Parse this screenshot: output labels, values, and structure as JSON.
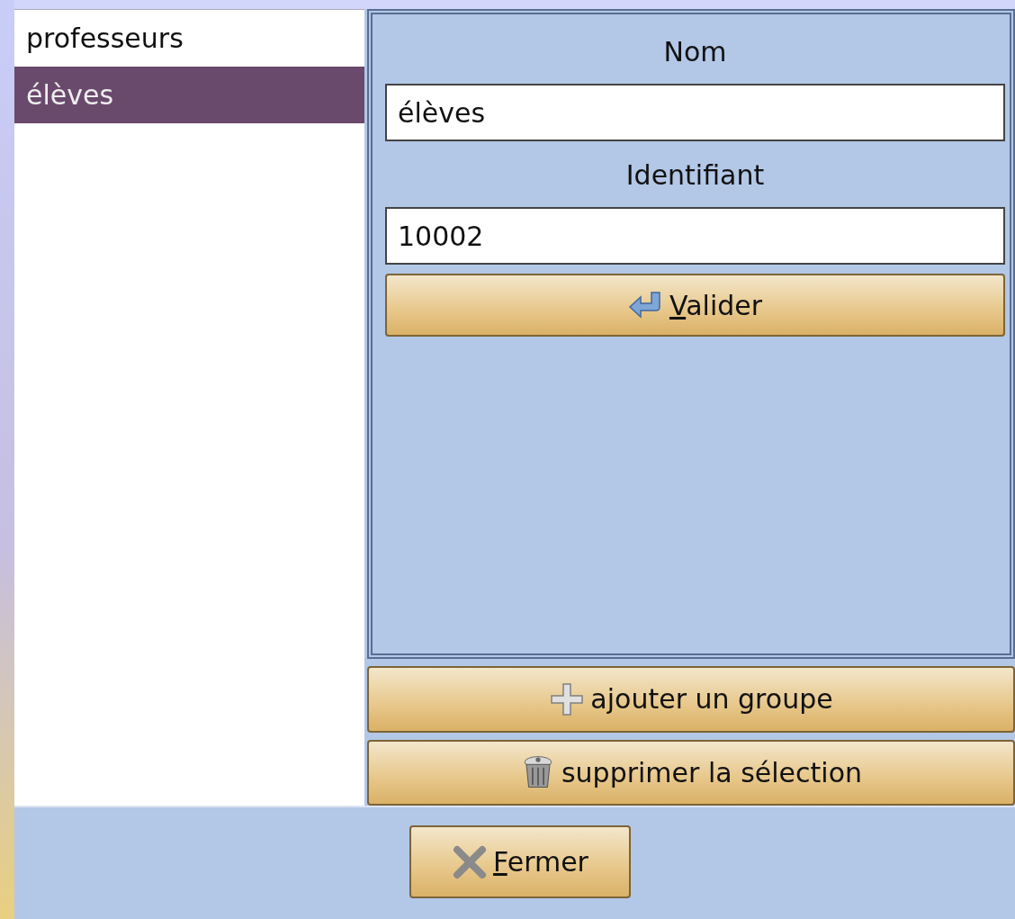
{
  "groups": [
    {
      "label": "professeurs",
      "selected": false
    },
    {
      "label": "élèves",
      "selected": true
    }
  ],
  "form": {
    "fields": [
      {
        "label": "Nom",
        "value": "élèves"
      },
      {
        "label": "Identifiant",
        "value": "10002"
      }
    ],
    "submit": {
      "label": "Valider",
      "mnemonic": true
    }
  },
  "actions": [
    {
      "kind": "add",
      "label": "ajouter un groupe"
    },
    {
      "kind": "delete",
      "label": "supprimer la sélection"
    }
  ],
  "close": {
    "label": "Fermer",
    "mnemonic": true
  }
}
